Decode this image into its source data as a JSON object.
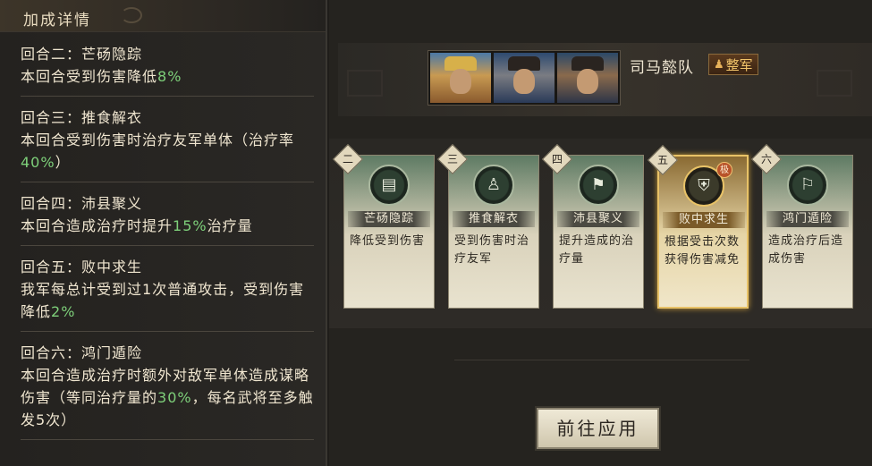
{
  "panel": {
    "title": "加成详情",
    "rounds": [
      {
        "head": "回合二：芒砀隐踪",
        "body_before": "本回合受到伤害降低",
        "highlight": "8%",
        "body_after": ""
      },
      {
        "head": "回合三：推食解衣",
        "body_before": "本回合受到伤害时治疗友军单体（治疗率",
        "highlight": "40%",
        "body_after": "）"
      },
      {
        "head": "回合四：沛县聚义",
        "body_before": "本回合造成治疗时提升",
        "highlight": "15%",
        "body_after": "治疗量"
      },
      {
        "head": "回合五：败中求生",
        "body_before": "我军每总计受到过1次普通攻击，受到伤害降低",
        "highlight": "2%",
        "body_after": ""
      },
      {
        "head": "回合六：鸿门遁险",
        "body_before": "本回合造成治疗时额外对敌军单体造成谋略伤害（等同治疗量的",
        "highlight": "30%",
        "body_after": "，每名武将至多触发5次）"
      }
    ]
  },
  "team": {
    "name": "司马懿队",
    "badge": "整军",
    "badge_icon": "troops-icon"
  },
  "cards": [
    {
      "num": "二",
      "name": "芒砀隐踪",
      "desc": "降低受到伤害",
      "icon": "book-icon",
      "glyph": "▤",
      "selected": false,
      "level": ""
    },
    {
      "num": "三",
      "name": "推食解衣",
      "desc": "受到伤害时治疗友军",
      "icon": "person-icon",
      "glyph": "♙",
      "selected": false,
      "level": ""
    },
    {
      "num": "四",
      "name": "沛县聚义",
      "desc": "提升造成的治疗量",
      "icon": "banner-icon",
      "glyph": "⚑",
      "selected": false,
      "level": ""
    },
    {
      "num": "五",
      "name": "败中求生",
      "desc": "根据受击次数获得伤害减免",
      "icon": "shield-icon",
      "glyph": "⛨",
      "selected": true,
      "level": "极"
    },
    {
      "num": "六",
      "name": "鸿门遁险",
      "desc": "造成治疗后造成伤害",
      "icon": "flag-icon",
      "glyph": "⚐",
      "selected": false,
      "level": ""
    }
  ],
  "apply_button": "前往应用"
}
